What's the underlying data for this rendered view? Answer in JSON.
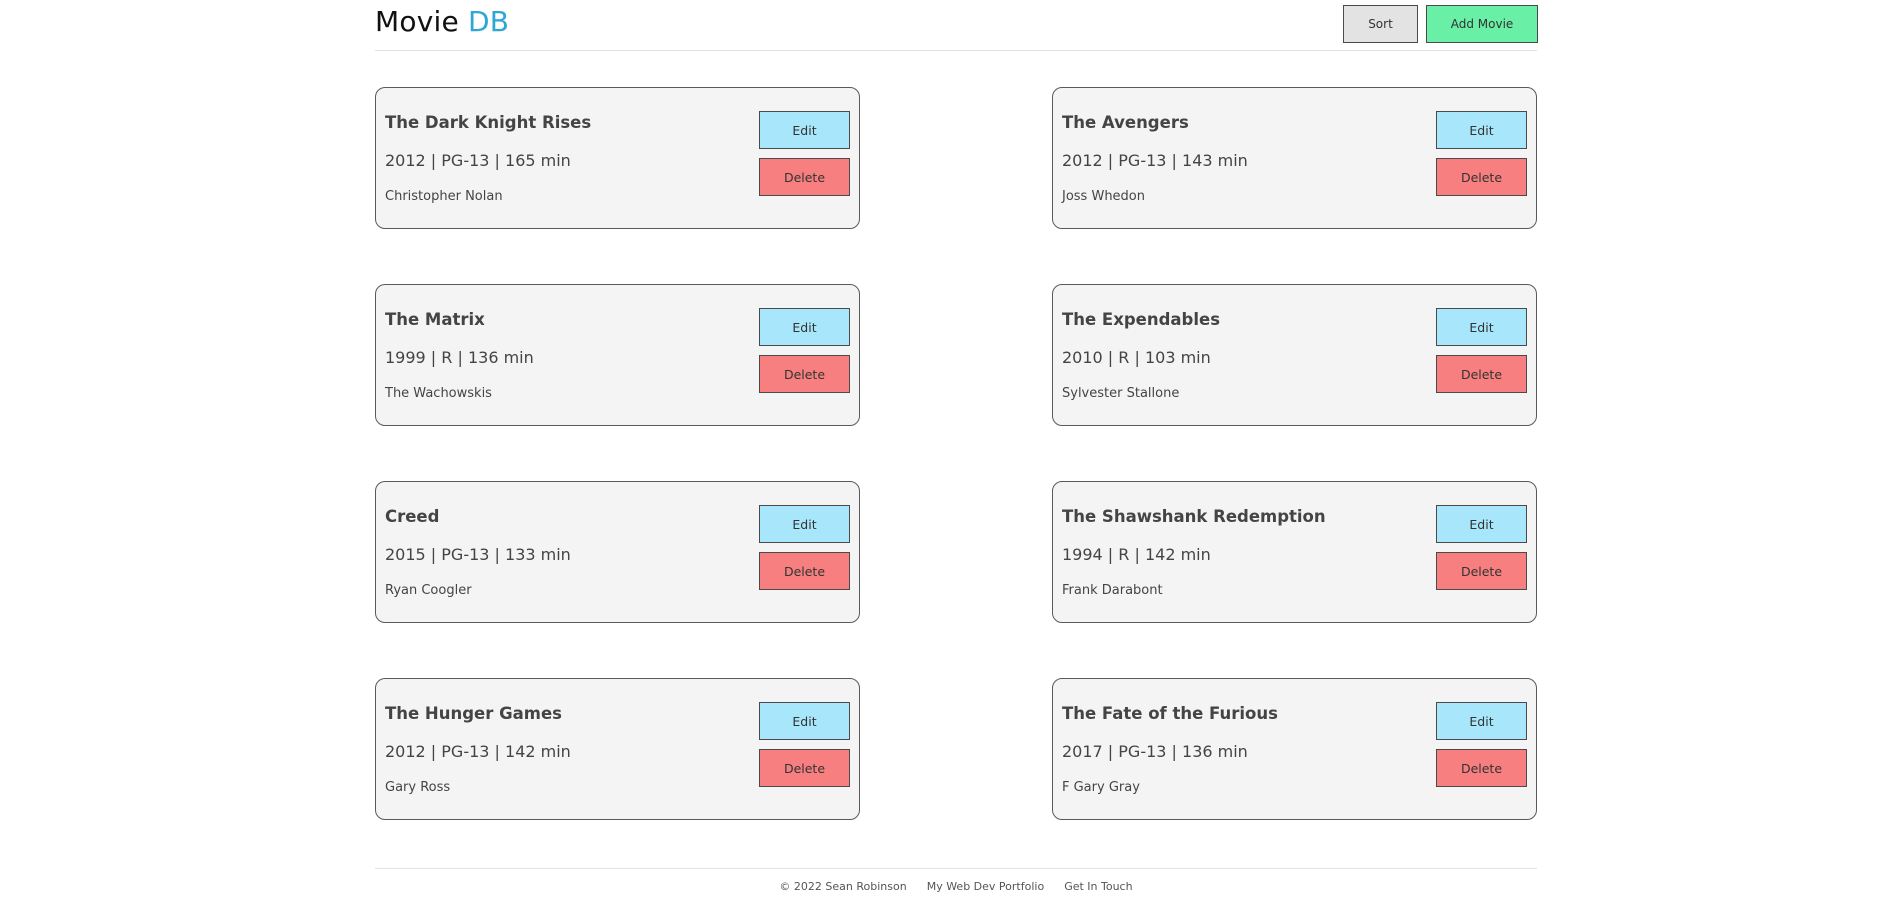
{
  "header": {
    "logo_main": "Movie",
    "logo_accent": "DB",
    "sort_label": "Sort",
    "add_label": "Add Movie"
  },
  "movies": [
    {
      "title": "The Dark Knight Rises",
      "meta": "2012 | PG-13 | 165 min",
      "director": "Christopher Nolan",
      "edit_label": "Edit",
      "delete_label": "Delete"
    },
    {
      "title": "The Avengers",
      "meta": "2012 | PG-13 | 143 min",
      "director": "Joss Whedon",
      "edit_label": "Edit",
      "delete_label": "Delete"
    },
    {
      "title": "The Matrix",
      "meta": "1999 | R | 136 min",
      "director": "The Wachowskis",
      "edit_label": "Edit",
      "delete_label": "Delete"
    },
    {
      "title": "The Expendables",
      "meta": "2010 | R | 103 min",
      "director": "Sylvester Stallone",
      "edit_label": "Edit",
      "delete_label": "Delete"
    },
    {
      "title": "Creed",
      "meta": "2015 | PG-13 | 133 min",
      "director": "Ryan Coogler",
      "edit_label": "Edit",
      "delete_label": "Delete"
    },
    {
      "title": "The Shawshank Redemption",
      "meta": "1994 | R | 142 min",
      "director": "Frank Darabont",
      "edit_label": "Edit",
      "delete_label": "Delete"
    },
    {
      "title": "The Hunger Games",
      "meta": "2012 | PG-13 | 142 min",
      "director": "Gary Ross",
      "edit_label": "Edit",
      "delete_label": "Delete"
    },
    {
      "title": "The Fate of the Furious",
      "meta": "2017 | PG-13 | 136 min",
      "director": "F Gary Gray",
      "edit_label": "Edit",
      "delete_label": "Delete"
    }
  ],
  "footer": {
    "copyright": "© 2022 Sean Robinson",
    "portfolio_link": "My Web Dev Portfolio",
    "contact_link": "Get In Touch"
  },
  "colors": {
    "accent": "#2ea6d6",
    "add_button": "#6af0a6",
    "edit_button": "#a8e7fb",
    "delete_button": "#f77f7f",
    "sort_button": "#e3e3e3",
    "card_background": "#f4f4f4"
  }
}
